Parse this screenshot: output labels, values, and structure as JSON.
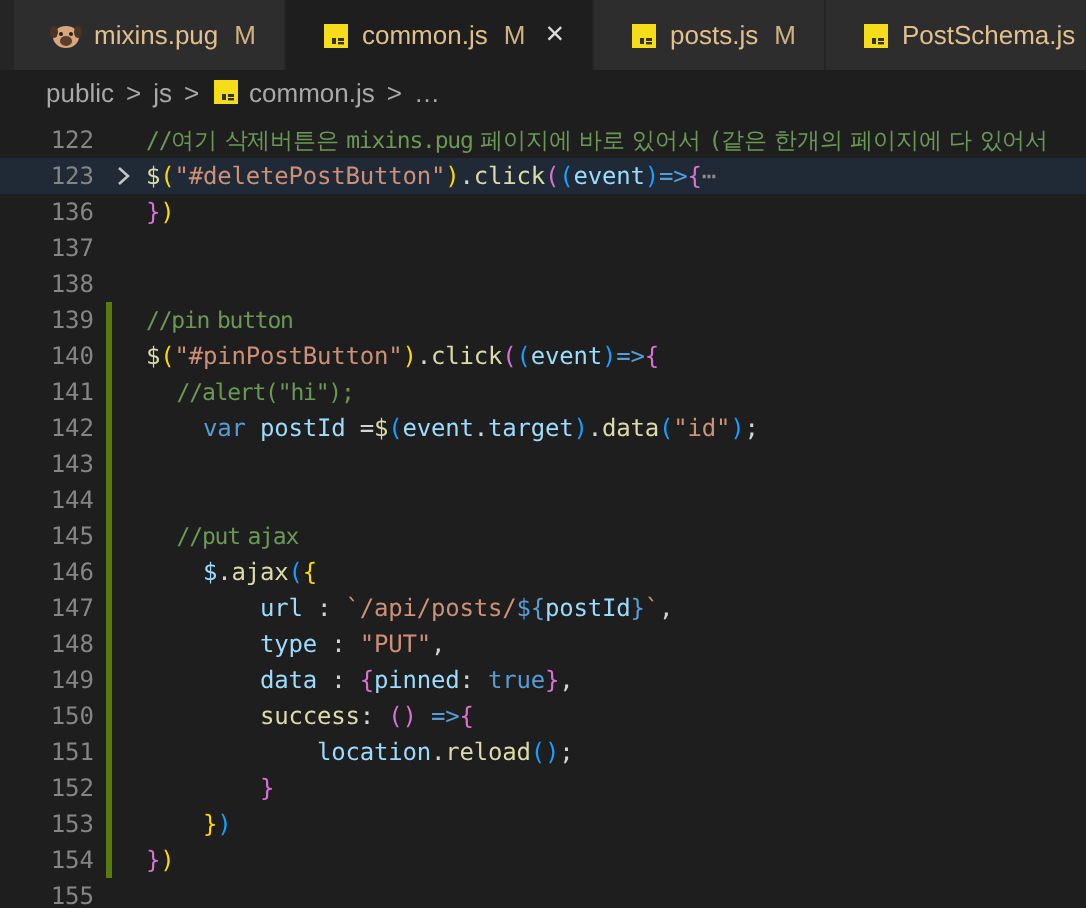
{
  "tabs": [
    {
      "label": "mixins.pug",
      "status": "M",
      "kind": "pug",
      "selected": false
    },
    {
      "label": "common.js",
      "status": "M",
      "kind": "js",
      "selected": true,
      "close": "×"
    },
    {
      "label": "posts.js",
      "status": "M",
      "kind": "js",
      "selected": false
    },
    {
      "label": "PostSchema.js",
      "kind": "js",
      "selected": false
    }
  ],
  "breadcrumb": [
    {
      "label": "public",
      "kind": "folder"
    },
    {
      "label": "js",
      "kind": "folder"
    },
    {
      "label": "common.js",
      "kind": "js"
    },
    {
      "label": "…",
      "kind": "more"
    }
  ],
  "breadcrumb_separator": ">",
  "lines": [
    {
      "number": "122",
      "modified": false,
      "folded": false,
      "tokens": [
        {
          "text": "//여기 삭제버튼은 mixins.pug 페이지에 바로 있어서 (같은 한개의 페이지에 다 있어서",
          "kind": "comment"
        }
      ]
    },
    {
      "number": "123",
      "modified": false,
      "folded": true,
      "tokens": [
        {
          "text": "$",
          "kind": "func"
        },
        {
          "text": "(",
          "kind": "b1"
        },
        {
          "text": "\"#deletePostButton\"",
          "kind": "string"
        },
        {
          "text": ")",
          "kind": "b1"
        },
        {
          "text": ".",
          "kind": "punct"
        },
        {
          "text": "click",
          "kind": "func"
        },
        {
          "text": "(",
          "kind": "b2"
        },
        {
          "text": "(",
          "kind": "b3"
        },
        {
          "text": "event",
          "kind": "var"
        },
        {
          "text": ")",
          "kind": "b3"
        },
        {
          "text": "=>",
          "kind": "keyword"
        },
        {
          "text": "{",
          "kind": "b2"
        },
        {
          "text": "⋯",
          "kind": "ellipsis"
        }
      ]
    },
    {
      "number": "136",
      "modified": false,
      "folded": false,
      "tokens": [
        {
          "text": "}",
          "kind": "b2"
        },
        {
          "text": ")",
          "kind": "b1"
        }
      ]
    },
    {
      "number": "137",
      "modified": false,
      "folded": false
    },
    {
      "number": "138",
      "modified": false,
      "folded": false
    },
    {
      "number": "139",
      "modified": true,
      "folded": false,
      "tokens": [
        {
          "text": "//pin button",
          "kind": "comment"
        }
      ]
    },
    {
      "number": "140",
      "modified": true,
      "folded": false,
      "tokens": [
        {
          "text": "$",
          "kind": "func"
        },
        {
          "text": "(",
          "kind": "b1"
        },
        {
          "text": "\"#pinPostButton\"",
          "kind": "string"
        },
        {
          "text": ")",
          "kind": "b1"
        },
        {
          "text": ".",
          "kind": "punct"
        },
        {
          "text": "click",
          "kind": "func"
        },
        {
          "text": "(",
          "kind": "b2"
        },
        {
          "text": "(",
          "kind": "b3"
        },
        {
          "text": "event",
          "kind": "var"
        },
        {
          "text": ")",
          "kind": "b3"
        },
        {
          "text": "=>",
          "kind": "keyword"
        },
        {
          "text": "{",
          "kind": "b2"
        }
      ]
    },
    {
      "number": "141",
      "modified": true,
      "folded": false,
      "tokens": [
        {
          "text": "    //alert(\"hi\");",
          "kind": "comment"
        }
      ]
    },
    {
      "number": "142",
      "modified": true,
      "folded": false,
      "tokens": [
        {
          "text": "    var",
          "kind": "keyword"
        },
        {
          "text": " postId",
          "kind": "var"
        },
        {
          "text": " =",
          "kind": "punct"
        },
        {
          "text": "$",
          "kind": "func"
        },
        {
          "text": "(",
          "kind": "b3"
        },
        {
          "text": "event",
          "kind": "var"
        },
        {
          "text": ".",
          "kind": "punct"
        },
        {
          "text": "target",
          "kind": "var"
        },
        {
          "text": ")",
          "kind": "b3"
        },
        {
          "text": ".",
          "kind": "punct"
        },
        {
          "text": "data",
          "kind": "func"
        },
        {
          "text": "(",
          "kind": "b3"
        },
        {
          "text": "\"id\"",
          "kind": "string"
        },
        {
          "text": ")",
          "kind": "b3"
        },
        {
          "text": ";",
          "kind": "punct"
        }
      ]
    },
    {
      "number": "143",
      "modified": true,
      "folded": false
    },
    {
      "number": "144",
      "modified": true,
      "folded": false
    },
    {
      "number": "145",
      "modified": true,
      "folded": false,
      "tokens": [
        {
          "text": "    //put ajax",
          "kind": "comment"
        }
      ]
    },
    {
      "number": "146",
      "modified": true,
      "folded": false,
      "tokens": [
        {
          "text": "    $",
          "kind": "var"
        },
        {
          "text": ".",
          "kind": "punct"
        },
        {
          "text": "ajax",
          "kind": "func"
        },
        {
          "text": "(",
          "kind": "b3"
        },
        {
          "text": "{",
          "kind": "b1"
        }
      ]
    },
    {
      "number": "147",
      "modified": true,
      "folded": false,
      "tokens": [
        {
          "text": "        url",
          "kind": "var"
        },
        {
          "text": " : ",
          "kind": "punct"
        },
        {
          "text": "`/api/posts/",
          "kind": "string"
        },
        {
          "text": "${",
          "kind": "keyword"
        },
        {
          "text": "postId",
          "kind": "var"
        },
        {
          "text": "}",
          "kind": "keyword"
        },
        {
          "text": "`",
          "kind": "string"
        },
        {
          "text": ",",
          "kind": "punct"
        }
      ]
    },
    {
      "number": "148",
      "modified": true,
      "folded": false,
      "tokens": [
        {
          "text": "        type",
          "kind": "var"
        },
        {
          "text": " : ",
          "kind": "punct"
        },
        {
          "text": "\"PUT\"",
          "kind": "string"
        },
        {
          "text": ",",
          "kind": "punct"
        }
      ]
    },
    {
      "number": "149",
      "modified": true,
      "folded": false,
      "tokens": [
        {
          "text": "        data",
          "kind": "var"
        },
        {
          "text": " : ",
          "kind": "punct"
        },
        {
          "text": "{",
          "kind": "b2"
        },
        {
          "text": "pinned",
          "kind": "var"
        },
        {
          "text": ": ",
          "kind": "punct"
        },
        {
          "text": "true",
          "kind": "keyword"
        },
        {
          "text": "}",
          "kind": "b2"
        },
        {
          "text": ",",
          "kind": "punct"
        }
      ]
    },
    {
      "number": "150",
      "modified": true,
      "folded": false,
      "tokens": [
        {
          "text": "        success",
          "kind": "func"
        },
        {
          "text": ": ",
          "kind": "punct"
        },
        {
          "text": "()",
          "kind": "b2"
        },
        {
          "text": " =>",
          "kind": "keyword"
        },
        {
          "text": "{",
          "kind": "b2"
        }
      ]
    },
    {
      "number": "151",
      "modified": true,
      "folded": false,
      "tokens": [
        {
          "text": "            location",
          "kind": "var"
        },
        {
          "text": ".",
          "kind": "punct"
        },
        {
          "text": "reload",
          "kind": "func"
        },
        {
          "text": "()",
          "kind": "b3"
        },
        {
          "text": ";",
          "kind": "punct"
        }
      ]
    },
    {
      "number": "152",
      "modified": true,
      "folded": false,
      "tokens": [
        {
          "text": "        }",
          "kind": "b2"
        }
      ]
    },
    {
      "number": "153",
      "modified": true,
      "folded": false,
      "tokens": [
        {
          "text": "    }",
          "kind": "b1"
        },
        {
          "text": ")",
          "kind": "b3"
        }
      ]
    },
    {
      "number": "154",
      "modified": true,
      "folded": false,
      "tokens": [
        {
          "text": "}",
          "kind": "b2"
        },
        {
          "text": ")",
          "kind": "b1"
        }
      ]
    },
    {
      "number": "155",
      "modified": false,
      "folded": false
    }
  ]
}
